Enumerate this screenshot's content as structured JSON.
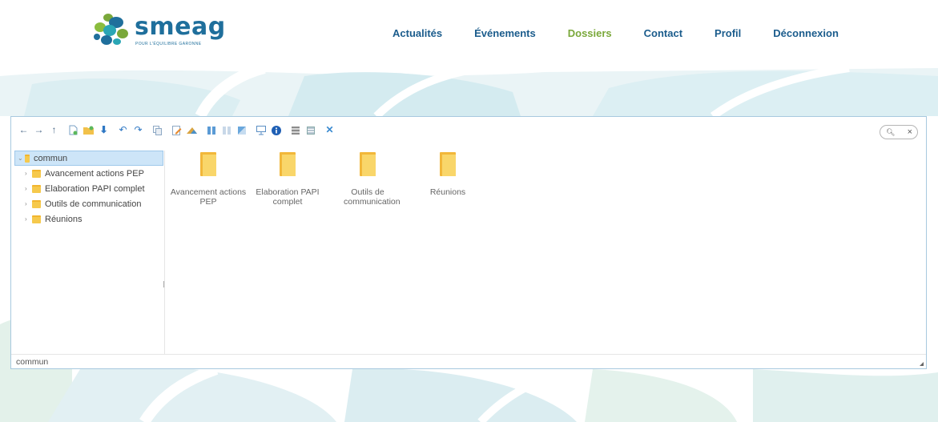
{
  "brand": {
    "name": "smeag",
    "tagline": "POUR L'ÉQUILIBRE GARONNE",
    "colors": {
      "blue": "#1f6f9c",
      "green": "#7aa83a",
      "teal": "#2aa6b5"
    }
  },
  "nav": {
    "items": [
      {
        "label": "Actualités",
        "active": false
      },
      {
        "label": "Événements",
        "active": false
      },
      {
        "label": "Dossiers",
        "active": true
      },
      {
        "label": "Contact",
        "active": false
      },
      {
        "label": "Profil",
        "active": false
      },
      {
        "label": "Déconnexion",
        "active": false
      }
    ],
    "active_color": "#7aa83a",
    "color": "#1b5c8c"
  },
  "toolbar": {
    "icons": [
      "back-icon",
      "forward-icon",
      "up-icon",
      "new-file-icon",
      "new-folder-icon",
      "download-icon",
      "undo-icon",
      "redo-icon",
      "copy-icon",
      "rename-icon",
      "edit-image-icon",
      "view-icons-icon",
      "view-list-icon",
      "extract-icon",
      "preview-icon",
      "info-icon",
      "select-all-icon",
      "select-invert-icon",
      "fullscreen-icon"
    ]
  },
  "search": {
    "icon": "search-icon",
    "clear": "×"
  },
  "tree": {
    "root": {
      "label": "commun",
      "expanded": true,
      "selected": true
    },
    "children": [
      {
        "label": "Avancement actions PEP"
      },
      {
        "label": "Elaboration PAPI complet"
      },
      {
        "label": "Outils de communication"
      },
      {
        "label": "Réunions"
      }
    ]
  },
  "files": [
    {
      "label": "Avancement actions PEP"
    },
    {
      "label": "Elaboration PAPI complet"
    },
    {
      "label": "Outils de communication"
    },
    {
      "label": "Réunions"
    }
  ],
  "statusbar": {
    "path": "commun"
  }
}
